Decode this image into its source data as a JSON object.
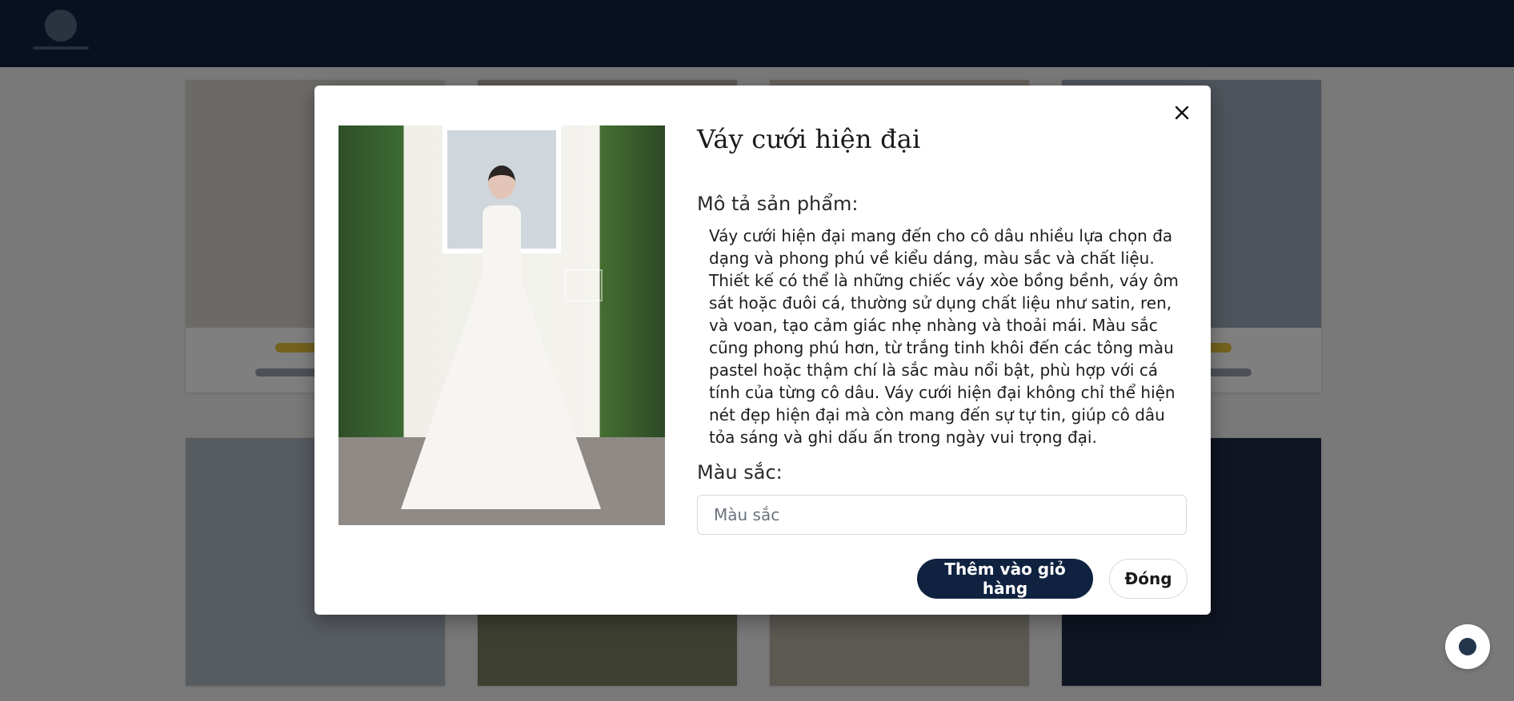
{
  "background": {
    "cards": [
      {
        "tone": "#d9d4cf"
      },
      {
        "tone": "#b7b0aa"
      },
      {
        "tone": "#cbbfb2"
      },
      {
        "tone": "#9aa9b6"
      },
      {
        "tone": "#aeb9c3"
      },
      {
        "tone": "#7a7f63"
      },
      {
        "tone": "#b9b3a7"
      },
      {
        "tone": "#1e2a44"
      }
    ]
  },
  "modal": {
    "title": "Váy cưới hiện đại",
    "description_label": "Mô tả sản phẩm:",
    "description": "Váy cưới hiện đại mang đến cho cô dâu nhiều lựa chọn đa dạng và phong phú về kiểu dáng, màu sắc và chất liệu. Thiết kế có thể là những chiếc váy xòe bồng bềnh, váy ôm sát hoặc đuôi cá, thường sử dụng chất liệu như satin, ren, và voan, tạo cảm giác nhẹ nhàng và thoải mái. Màu sắc cũng phong phú hơn, từ trắng tinh khôi đến các tông màu pastel hoặc thậm chí là sắc màu nổi bật, phù hợp với cá tính của từng cô dâu. Váy cưới hiện đại không chỉ thể hiện nét đẹp hiện đại mà còn mang đến sự tự tin, giúp cô dâu tỏa sáng và ghi dấu ấn trong ngày vui trọng đại.",
    "color_label": "Màu sắc:",
    "color_input": {
      "value": "",
      "placeholder": "Màu sắc"
    },
    "add_to_cart_label": "Thêm vào giỏ hàng",
    "close_label": "Đóng",
    "close_icon": "close-icon"
  },
  "colors": {
    "brand_navy": "#0f2340",
    "backdrop": "rgba(0,0,0,0.5)"
  }
}
